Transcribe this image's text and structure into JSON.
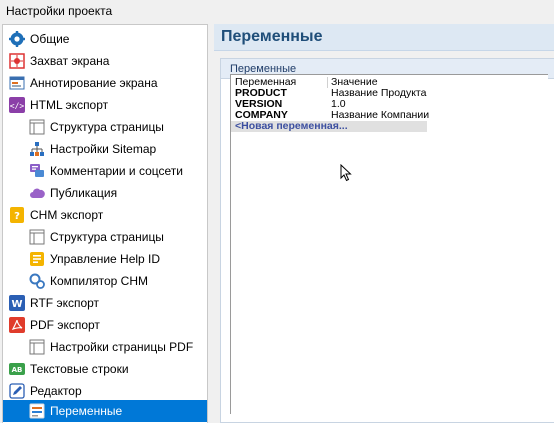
{
  "window": {
    "title": "Настройки проекта"
  },
  "sidebar": {
    "items": [
      {
        "label": "Общие",
        "level": 0,
        "icon": "gear-icon"
      },
      {
        "label": "Захват экрана",
        "level": 0,
        "icon": "screen-capture-icon"
      },
      {
        "label": "Аннотирование экрана",
        "level": 0,
        "icon": "annotation-icon"
      },
      {
        "label": "HTML экспорт",
        "level": 0,
        "icon": "html-export-icon"
      },
      {
        "label": "Структура страницы",
        "level": 1,
        "icon": "page-layout-icon"
      },
      {
        "label": "Настройки Sitemap",
        "level": 1,
        "icon": "sitemap-icon"
      },
      {
        "label": "Комментарии и соцсети",
        "level": 1,
        "icon": "comments-icon"
      },
      {
        "label": "Публикация",
        "level": 1,
        "icon": "cloud-icon"
      },
      {
        "label": "CHM экспорт",
        "level": 0,
        "icon": "chm-help-icon"
      },
      {
        "label": "Структура страницы",
        "level": 1,
        "icon": "page-layout-icon"
      },
      {
        "label": "Управление Help ID",
        "level": 1,
        "icon": "help-id-icon"
      },
      {
        "label": "Компилятор CHM",
        "level": 1,
        "icon": "compiler-gears-icon"
      },
      {
        "label": "RTF экспорт",
        "level": 0,
        "icon": "word-icon"
      },
      {
        "label": "PDF экспорт",
        "level": 0,
        "icon": "pdf-icon"
      },
      {
        "label": "Настройки страницы PDF",
        "level": 1,
        "icon": "page-layout-icon"
      },
      {
        "label": "Текстовые строки",
        "level": 0,
        "icon": "text-strings-icon"
      },
      {
        "label": "Редактор",
        "level": 0,
        "icon": "editor-pencil-icon"
      },
      {
        "label": "Переменные",
        "level": 1,
        "icon": "variables-icon",
        "selected": true
      }
    ]
  },
  "main": {
    "title": "Переменные",
    "panel_caption": "Переменные",
    "grid": {
      "headers": [
        "Переменная",
        "Значение"
      ],
      "rows": [
        {
          "name": "PRODUCT",
          "value": "Название Продукта"
        },
        {
          "name": "VERSION",
          "value": "1.0"
        },
        {
          "name": "COMPANY",
          "value": "Название Компании"
        }
      ],
      "new_row_label": "<Новая переменная..."
    }
  },
  "colors": {
    "selection": "#0078d7",
    "header_bg": "#dde8f3",
    "title_text": "#1f4e79",
    "new_row_text": "#3c4fa0"
  }
}
